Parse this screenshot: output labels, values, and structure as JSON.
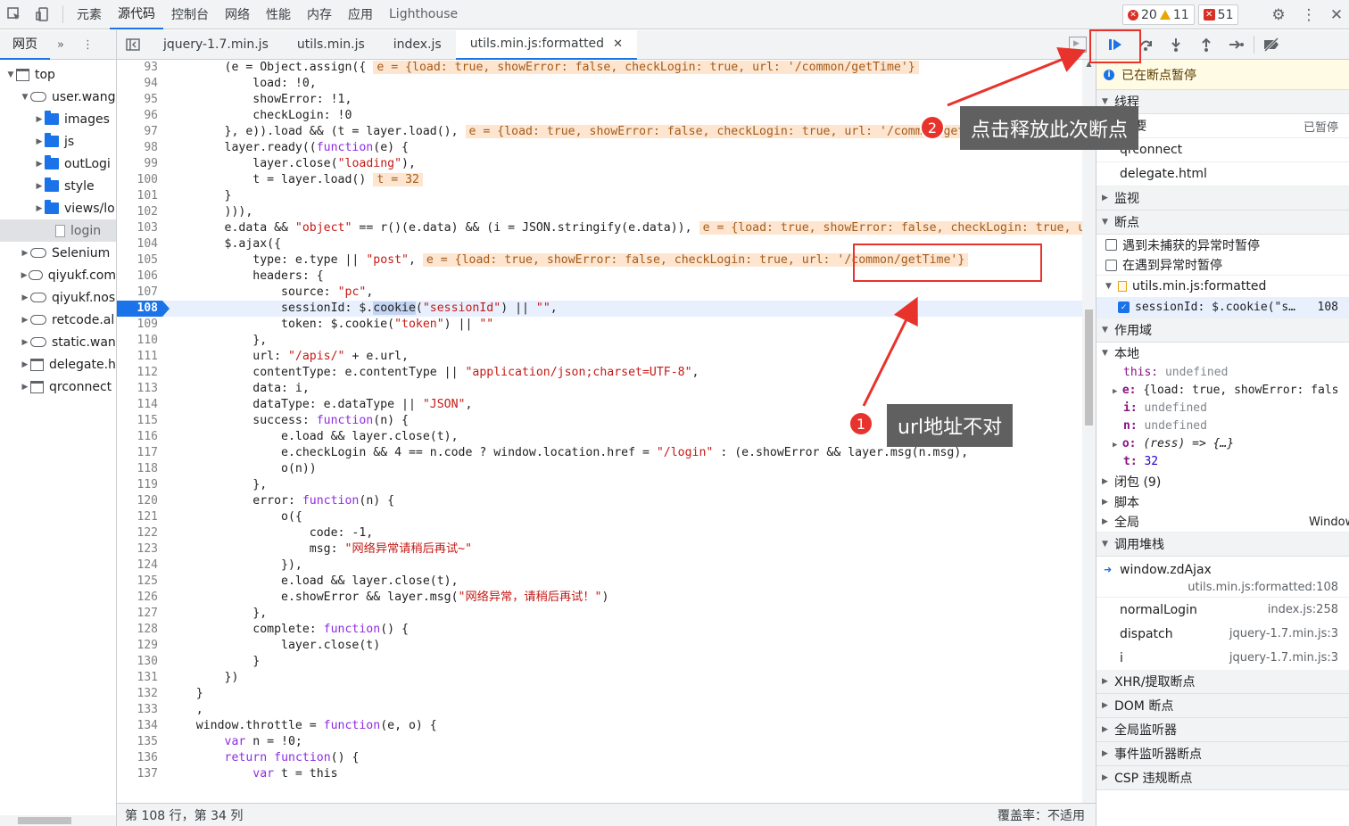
{
  "topbar": {
    "tabs": [
      "元素",
      "源代码",
      "控制台",
      "网络",
      "性能",
      "内存",
      "应用",
      "Lighthouse"
    ],
    "errors": "20",
    "warnings": "11",
    "issues": "51"
  },
  "navigator": {
    "header": "网页",
    "items": [
      {
        "label": "top",
        "kind": "frame"
      },
      {
        "label": "user.wang",
        "kind": "cloud"
      },
      {
        "label": "images",
        "kind": "folder"
      },
      {
        "label": "js",
        "kind": "folder"
      },
      {
        "label": "outLogi",
        "kind": "folder"
      },
      {
        "label": "style",
        "kind": "folder"
      },
      {
        "label": "views/lo",
        "kind": "folder"
      },
      {
        "label": "login",
        "kind": "file"
      },
      {
        "label": "Selenium",
        "kind": "cloud"
      },
      {
        "label": "qiyukf.com",
        "kind": "cloud"
      },
      {
        "label": "qiyukf.nos",
        "kind": "cloud"
      },
      {
        "label": "retcode.al",
        "kind": "cloud"
      },
      {
        "label": "static.wan",
        "kind": "cloud"
      },
      {
        "label": "delegate.h",
        "kind": "frame"
      },
      {
        "label": "qrconnect",
        "kind": "frame"
      }
    ]
  },
  "editor": {
    "tabs": [
      "jquery-1.7.min.js",
      "utils.min.js",
      "index.js",
      "utils.min.js:formatted"
    ],
    "status_left": "第 108 行，第 34 列",
    "status_right": "覆盖率：不适用"
  },
  "code_lines": [
    {
      "n": "93",
      "t": "        (e = Object.assign({",
      "inl": "e = {load: true, showError: false, checkLogin: true, url: '/common/getTime'}"
    },
    {
      "n": "94",
      "t": "            load: !0,"
    },
    {
      "n": "95",
      "t": "            showError: !1,"
    },
    {
      "n": "96",
      "t": "            checkLogin: !0"
    },
    {
      "n": "97",
      "t": "        }, e)).load && (t = layer.load(),",
      "inl": "e = {load: true, showError: false, checkLogin: true, url: '/common/getTime'}"
    },
    {
      "n": "98",
      "t": "        layer.ready((function(e) {"
    },
    {
      "n": "99",
      "t": "            layer.close(\"loading\"),"
    },
    {
      "n": "100",
      "t": "            t = layer.load()",
      "inl": "t = 32"
    },
    {
      "n": "101",
      "t": "        }"
    },
    {
      "n": "102",
      "t": "        ))),"
    },
    {
      "n": "103",
      "t": "        e.data && \"object\" == r()(e.data) && (i = JSON.stringify(e.data)),",
      "inl": "e = {load: true, showError: false, checkLogin: true, url: '/common/getTime'}"
    },
    {
      "n": "104",
      "t": "        $.ajax({"
    },
    {
      "n": "105",
      "t": "            type: e.type || \"post\",",
      "inl": "e = {load: true, showError: false, checkLogin: true, url: '/common/getTime'}"
    },
    {
      "n": "106",
      "t": "            headers: {"
    },
    {
      "n": "107",
      "t": "                source: \"pc\","
    },
    {
      "n": "108",
      "t": "                sessionId: $.cookie(\"sessionId\") || \"\",",
      "exec": true
    },
    {
      "n": "109",
      "t": "                token: $.cookie(\"token\") || \"\""
    },
    {
      "n": "110",
      "t": "            },"
    },
    {
      "n": "111",
      "t": "            url: \"/apis/\" + e.url,"
    },
    {
      "n": "112",
      "t": "            contentType: e.contentType || \"application/json;charset=UTF-8\","
    },
    {
      "n": "113",
      "t": "            data: i,"
    },
    {
      "n": "114",
      "t": "            dataType: e.dataType || \"JSON\","
    },
    {
      "n": "115",
      "t": "            success: function(n) {"
    },
    {
      "n": "116",
      "t": "                e.load && layer.close(t),"
    },
    {
      "n": "117",
      "t": "                e.checkLogin && 4 == n.code ? window.location.href = \"/login\" : (e.showError && layer.msg(n.msg),"
    },
    {
      "n": "118",
      "t": "                o(n))"
    },
    {
      "n": "119",
      "t": "            },"
    },
    {
      "n": "120",
      "t": "            error: function(n) {"
    },
    {
      "n": "121",
      "t": "                o({"
    },
    {
      "n": "122",
      "t": "                    code: -1,"
    },
    {
      "n": "123",
      "t": "                    msg: \"网络异常请稍后再试~\""
    },
    {
      "n": "124",
      "t": "                }),"
    },
    {
      "n": "125",
      "t": "                e.load && layer.close(t),"
    },
    {
      "n": "126",
      "t": "                e.showError && layer.msg(\"网络异常，请稍后再试！\")"
    },
    {
      "n": "127",
      "t": "            },"
    },
    {
      "n": "128",
      "t": "            complete: function() {"
    },
    {
      "n": "129",
      "t": "                layer.close(t)"
    },
    {
      "n": "130",
      "t": "            }"
    },
    {
      "n": "131",
      "t": "        })"
    },
    {
      "n": "132",
      "t": "    }"
    },
    {
      "n": "133",
      "t": "    ,"
    },
    {
      "n": "134",
      "t": "    window.throttle = function(e, o) {"
    },
    {
      "n": "135",
      "t": "        var n = !0;"
    },
    {
      "n": "136",
      "t": "        return function() {"
    },
    {
      "n": "137",
      "t": "            var t = this"
    }
  ],
  "debug": {
    "paused": "已在断点暂停",
    "threads_title": "线程",
    "threads": [
      {
        "name": "主要",
        "status": "已暂停"
      },
      {
        "name": "qrconnect",
        "status": ""
      },
      {
        "name": "delegate.html",
        "status": ""
      }
    ],
    "watch_title": "监视",
    "breakpoints_title": "断点",
    "bp_uncaught": "遇到未捕获的异常时暂停",
    "bp_caught": "在遇到异常时暂停",
    "bp_file": "utils.min.js:formatted",
    "bp_entry": "sessionId: $.cookie(\"s…",
    "bp_line": "108",
    "scope_title": "作用域",
    "local_title": "本地",
    "scope": {
      "this_k": "this:",
      "this_v": "undefined",
      "e_k": "e:",
      "e_v": "{load: true, showError: fals",
      "i_k": "i:",
      "i_v": "undefined",
      "n_k": "n:",
      "n_v": "undefined",
      "o_k": "o:",
      "o_v": "(ress) => {…}",
      "t_k": "t:",
      "t_v": "32"
    },
    "closure": "闭包 (9)",
    "script": "脚本",
    "global": "全局",
    "global_val": "Window",
    "callstack_title": "调用堆栈",
    "callstack": [
      {
        "fn": "window.zdAjax",
        "loc": "utils.min.js:formatted:108"
      },
      {
        "fn": "normalLogin",
        "loc": "index.js:258"
      },
      {
        "fn": "dispatch",
        "loc": "jquery-1.7.min.js:3"
      },
      {
        "fn": "i",
        "loc": "jquery-1.7.min.js:3"
      }
    ],
    "xhr": "XHR/提取断点",
    "dom": "DOM 断点",
    "global_listeners": "全局监听器",
    "event_bp": "事件监听器断点",
    "csp": "CSP 违规断点"
  },
  "annotations": {
    "badge1": "1",
    "callout1": "url地址不对",
    "badge2": "2",
    "callout2": "点击释放此次断点"
  },
  "colors": {
    "accent": "#1a73e8",
    "annotation_red": "#e8332c"
  }
}
